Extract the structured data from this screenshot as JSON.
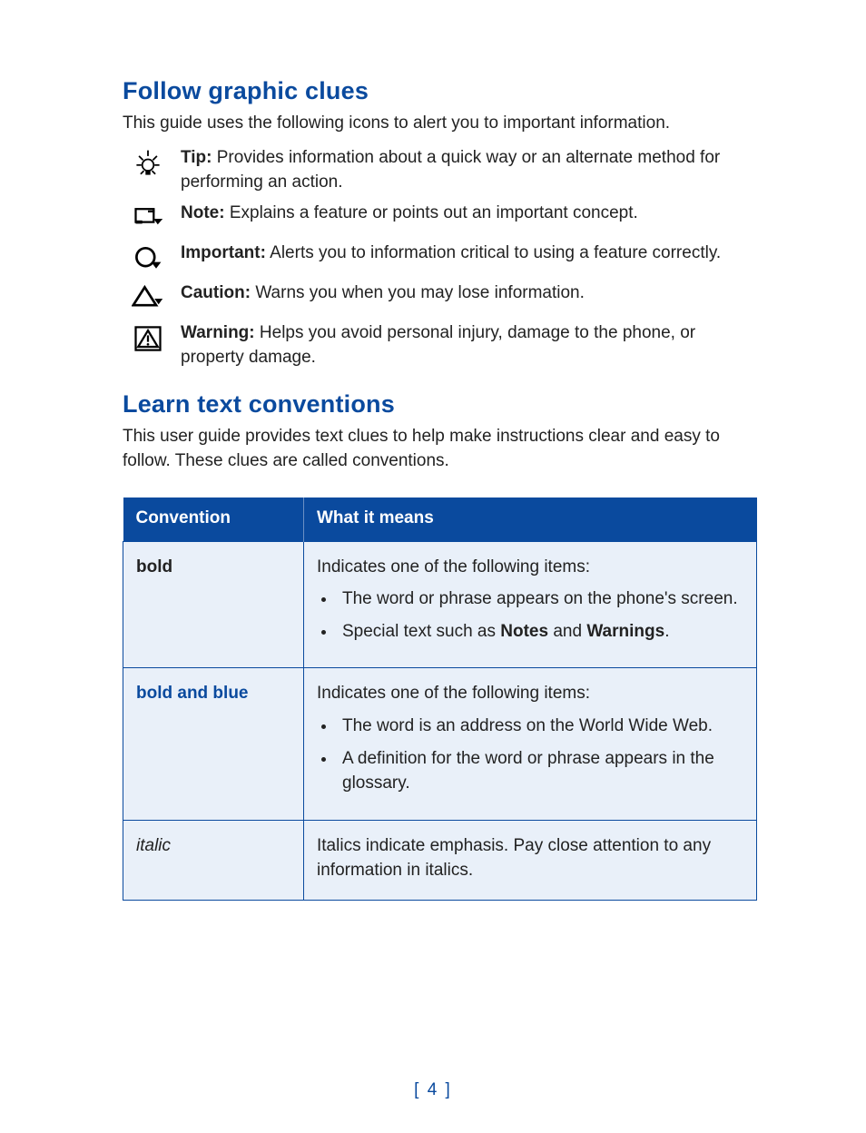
{
  "section1": {
    "heading": "Follow graphic clues",
    "intro": "This guide uses the following icons to alert you to important information.",
    "items": [
      {
        "icon": "tip-icon",
        "label": "Tip:",
        "text": " Provides information about a quick way or an alternate method for performing an action."
      },
      {
        "icon": "note-icon",
        "label": "Note:",
        "text": "  Explains a feature or points out an important concept."
      },
      {
        "icon": "important-icon",
        "label": "Important:",
        "text": " Alerts you to information critical to using a feature correctly."
      },
      {
        "icon": "caution-icon",
        "label": "Caution:",
        "text": " Warns you when you may lose information."
      },
      {
        "icon": "warning-icon",
        "label": "Warning:",
        "text": " Helps you avoid personal injury, damage to the phone, or property damage."
      }
    ]
  },
  "section2": {
    "heading": "Learn text conventions",
    "intro": "This user guide provides text clues to help make instructions clear and easy to follow. These clues are called conventions."
  },
  "table": {
    "headers": [
      "Convention",
      "What it means"
    ],
    "rows": [
      {
        "name": "bold",
        "style": "bold",
        "lead": "Indicates one of the following items:",
        "bullets": [
          {
            "pre": "The word or phrase appears on the phone's screen."
          },
          {
            "pre": "Special text such as ",
            "b1": "Notes",
            "mid": " and ",
            "b2": "Warnings",
            "post": "."
          }
        ]
      },
      {
        "name": "bold and blue",
        "style": "bold blue",
        "lead": "Indicates one of the following items:",
        "bullets": [
          {
            "pre": "The word is an address on the World Wide Web."
          },
          {
            "pre": "A definition for the word or phrase appears in the glossary."
          }
        ]
      },
      {
        "name": "italic",
        "style": "italic",
        "lead": "Italics indicate emphasis. Pay close attention to any information in italics."
      }
    ]
  },
  "page_number": "[ 4 ]"
}
